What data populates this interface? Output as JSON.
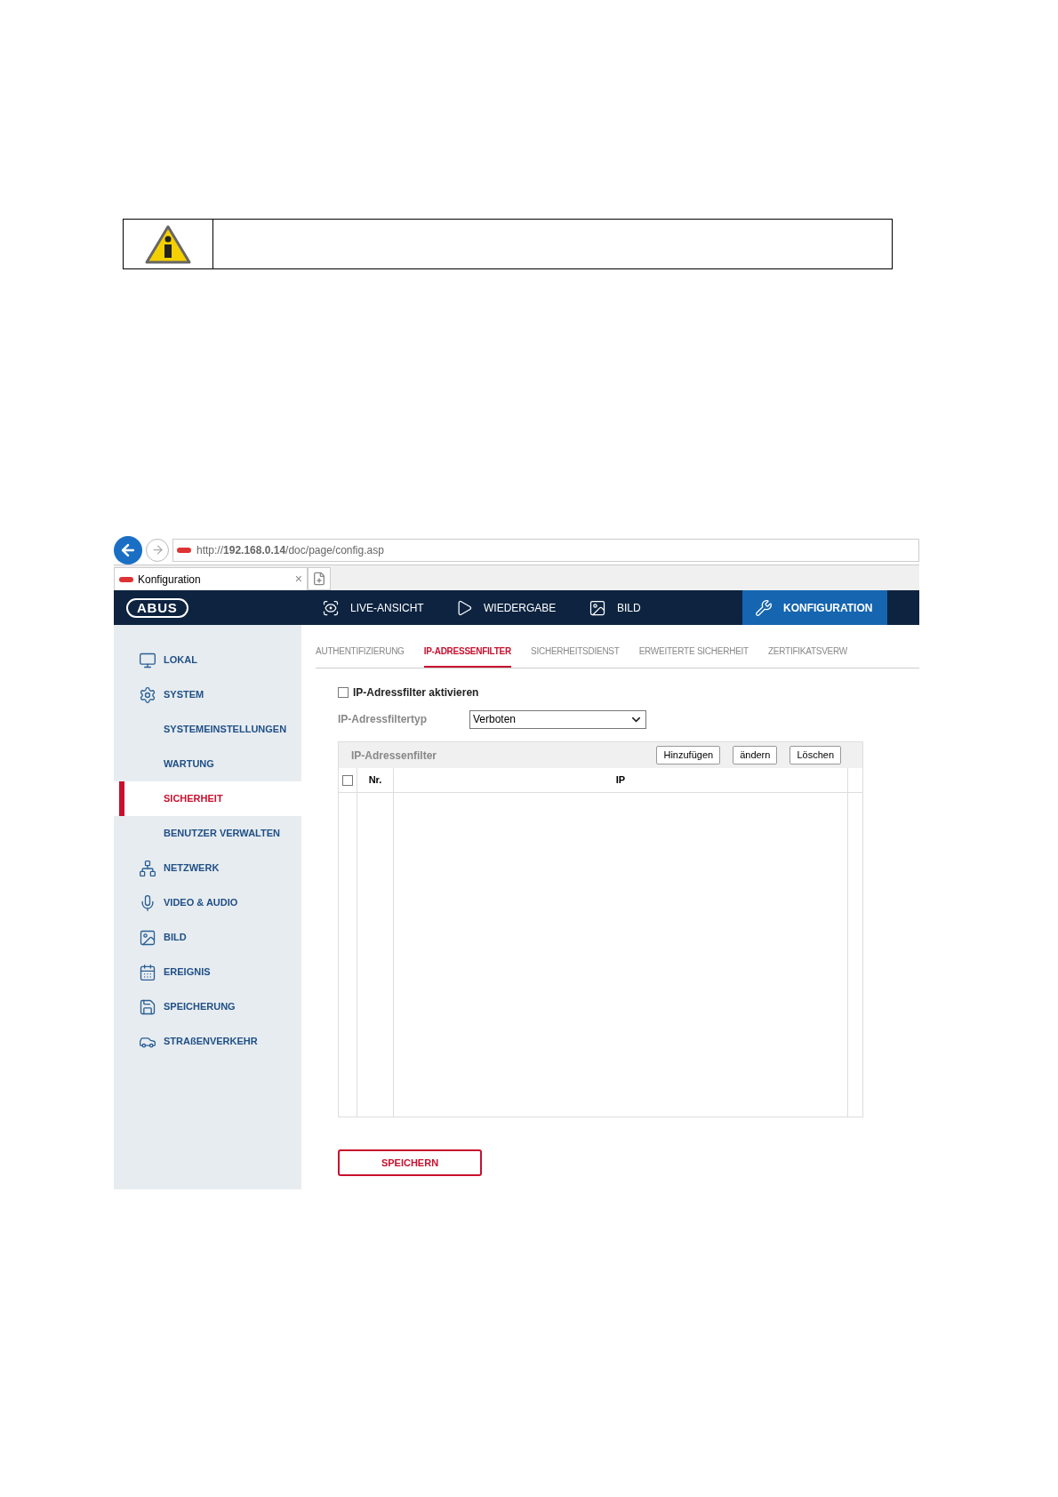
{
  "browser": {
    "address": "http://**192.168.0.14**/doc/page/config.asp",
    "tab": {
      "title": "Konfiguration",
      "close": "×"
    }
  },
  "app": {
    "logo": "ABUS",
    "nav": [
      {
        "label": "LIVE-ANSICHT",
        "selected": false
      },
      {
        "label": "WIEDERGABE",
        "selected": false
      },
      {
        "label": "BILD",
        "selected": false
      },
      {
        "label": "KONFIGURATION",
        "selected": true
      }
    ],
    "sidebar": [
      {
        "label": "LOKAL",
        "kind": "main",
        "selected": false
      },
      {
        "label": "SYSTEM",
        "kind": "main",
        "selected": false
      },
      {
        "label": "SYSTEMEINSTELLUNGEN",
        "kind": "sub",
        "selected": false
      },
      {
        "label": "WARTUNG",
        "kind": "sub",
        "selected": false
      },
      {
        "label": "SICHERHEIT",
        "kind": "sub",
        "selected": true
      },
      {
        "label": "BENUTZER VERWALTEN",
        "kind": "sub",
        "selected": false
      },
      {
        "label": "NETZWERK",
        "kind": "main",
        "selected": false
      },
      {
        "label": "VIDEO & AUDIO",
        "kind": "main",
        "selected": false
      },
      {
        "label": "BILD",
        "kind": "main",
        "selected": false
      },
      {
        "label": "EREIGNIS",
        "kind": "main",
        "selected": false
      },
      {
        "label": "SPEICHERUNG",
        "kind": "main",
        "selected": false
      },
      {
        "label": "STRAßENVERKEHR",
        "kind": "main",
        "selected": false
      }
    ],
    "subtabs": [
      {
        "label": "AUTHENTIFIZIERUNG",
        "selected": false
      },
      {
        "label": "IP-ADRESSENFILTER",
        "selected": true
      },
      {
        "label": "SICHERHEITSDIENST",
        "selected": false
      },
      {
        "label": "ERWEITERTE SICHERHEIT",
        "selected": false
      },
      {
        "label": "ZERTIFIKATSVERW",
        "selected": false
      }
    ],
    "enable": {
      "label": "IP-Adressfilter aktivieren",
      "checked": false
    },
    "filter_type": {
      "label": "IP-Adressfiltertyp",
      "value": "Verboten"
    },
    "table": {
      "title": "IP-Adressenfilter",
      "buttons": [
        "Hinzufügen",
        "ändern",
        "Löschen"
      ],
      "select_all_checked": false,
      "columns": [
        "Nr.",
        "IP"
      ]
    },
    "save_button": "SPEICHERN"
  }
}
